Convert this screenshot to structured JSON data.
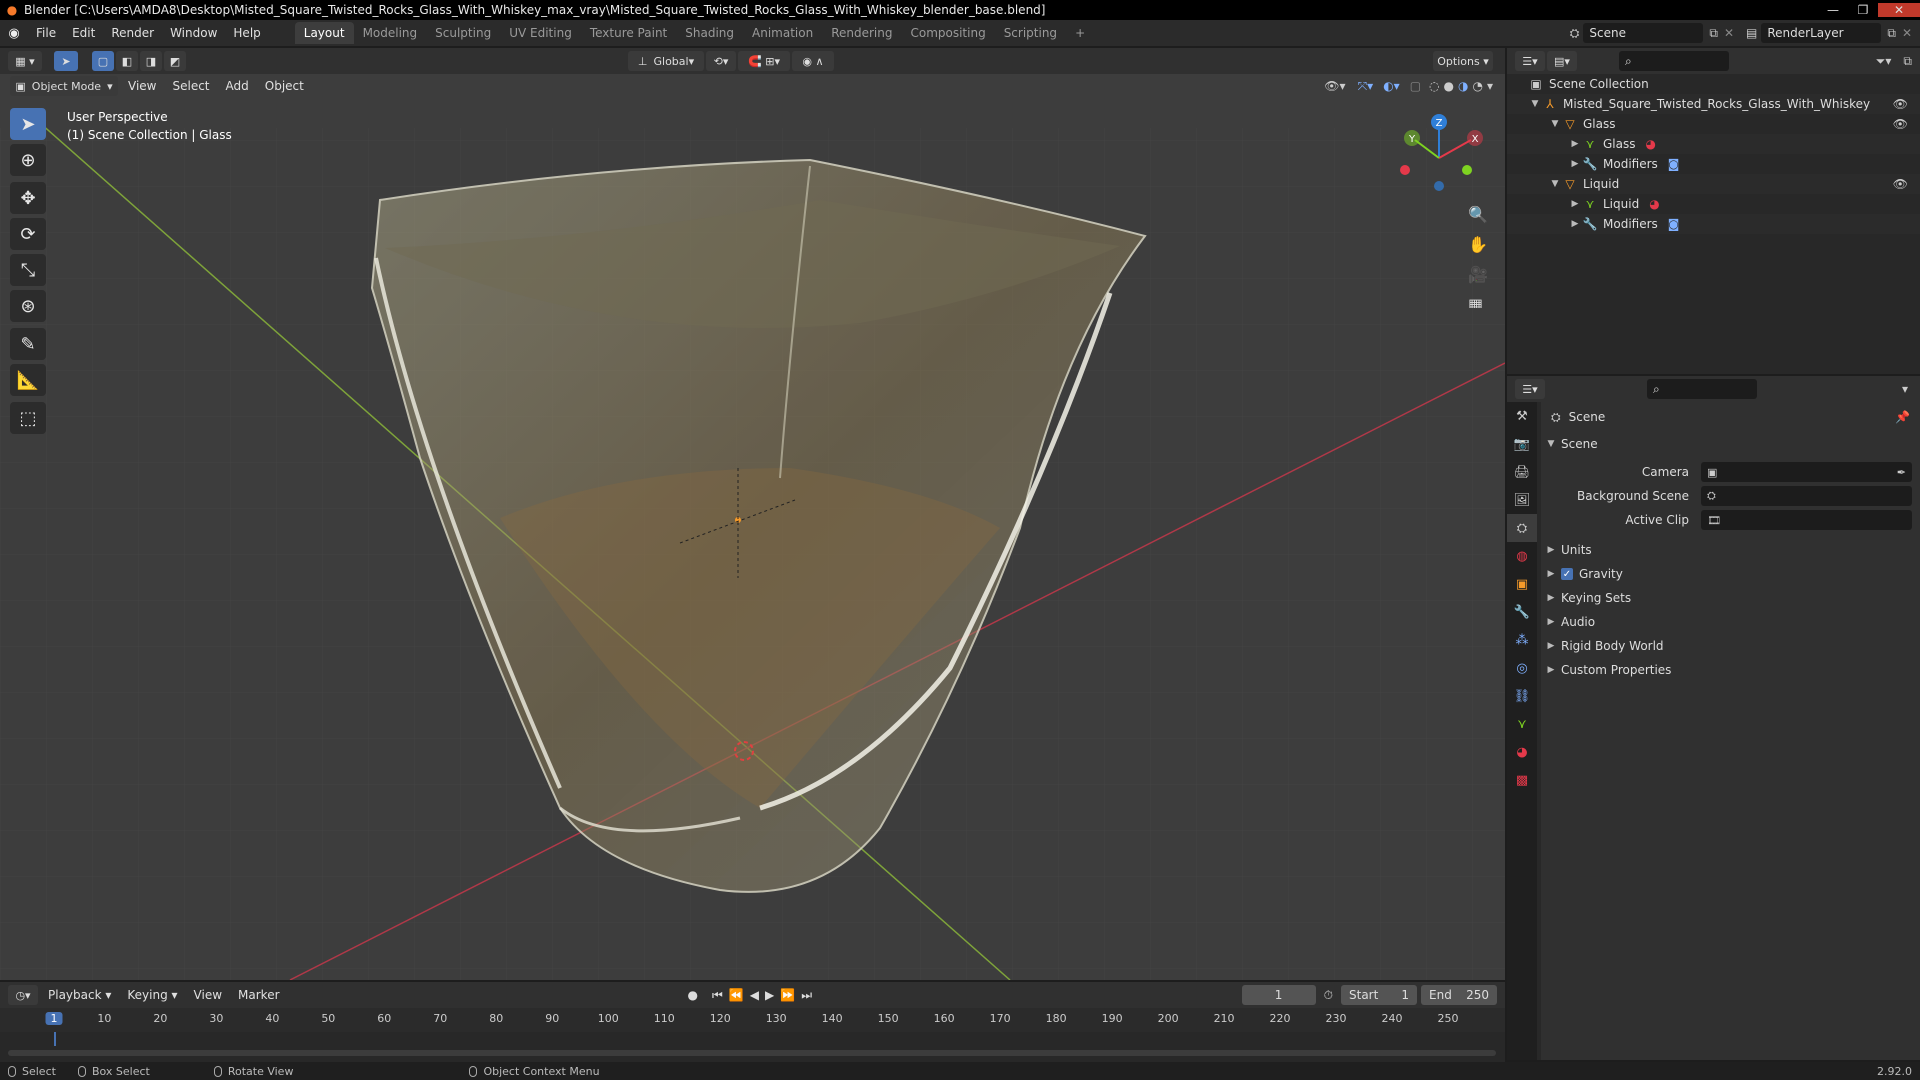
{
  "window": {
    "title": "Blender [C:\\Users\\AMDA8\\Desktop\\Misted_Square_Twisted_Rocks_Glass_With_Whiskey_max_vray\\Misted_Square_Twisted_Rocks_Glass_With_Whiskey_blender_base.blend]",
    "min": "—",
    "max": "❐",
    "close": "✕"
  },
  "menu": [
    "File",
    "Edit",
    "Render",
    "Window",
    "Help"
  ],
  "workspaces": [
    "Layout",
    "Modeling",
    "Sculpting",
    "UV Editing",
    "Texture Paint",
    "Shading",
    "Animation",
    "Rendering",
    "Compositing",
    "Scripting"
  ],
  "workspace_add": "+",
  "scene_name": "Scene",
  "render_layer": "RenderLayer",
  "viewport": {
    "transform": "Global",
    "options": "Options",
    "mode": "Object Mode",
    "menus": [
      "View",
      "Select",
      "Add",
      "Object"
    ],
    "info_line1": "User Perspective",
    "info_line2": "(1) Scene Collection | Glass",
    "gizmo": {
      "x": "X",
      "y": "Y",
      "z": "Z"
    }
  },
  "outliner": {
    "root": "Scene Collection",
    "collection": "Misted_Square_Twisted_Rocks_Glass_With_Whiskey",
    "objects": [
      {
        "name": "Glass",
        "mesh": "Glass",
        "modifiers": "Modifiers"
      },
      {
        "name": "Liquid",
        "mesh": "Liquid",
        "modifiers": "Modifiers"
      }
    ]
  },
  "properties": {
    "context": "Scene",
    "panel": "Scene",
    "camera_label": "Camera",
    "bg_scene_label": "Background Scene",
    "active_clip_label": "Active Clip",
    "panels": [
      "Units",
      "Gravity",
      "Keying Sets",
      "Audio",
      "Rigid Body World",
      "Custom Properties"
    ],
    "gravity_checked": true
  },
  "timeline": {
    "menus": [
      "Playback",
      "Keying",
      "View",
      "Marker"
    ],
    "current_frame": "1",
    "start_label": "Start",
    "start": "1",
    "end_label": "End",
    "end": "250",
    "ticks": [
      "1",
      "10",
      "20",
      "30",
      "40",
      "50",
      "60",
      "70",
      "80",
      "90",
      "100",
      "110",
      "120",
      "130",
      "140",
      "150",
      "160",
      "170",
      "180",
      "190",
      "200",
      "210",
      "220",
      "230",
      "240",
      "250"
    ]
  },
  "status": {
    "select": "Select",
    "box_select": "Box Select",
    "rotate_view": "Rotate View",
    "context_menu": "Object Context Menu",
    "version": "2.92.0"
  },
  "colors": {
    "accent": "#4772b3",
    "x_axis": "#e5394a",
    "y_axis": "#7ed321",
    "z_axis": "#2f7fd8",
    "orange": "#f59a2a"
  }
}
